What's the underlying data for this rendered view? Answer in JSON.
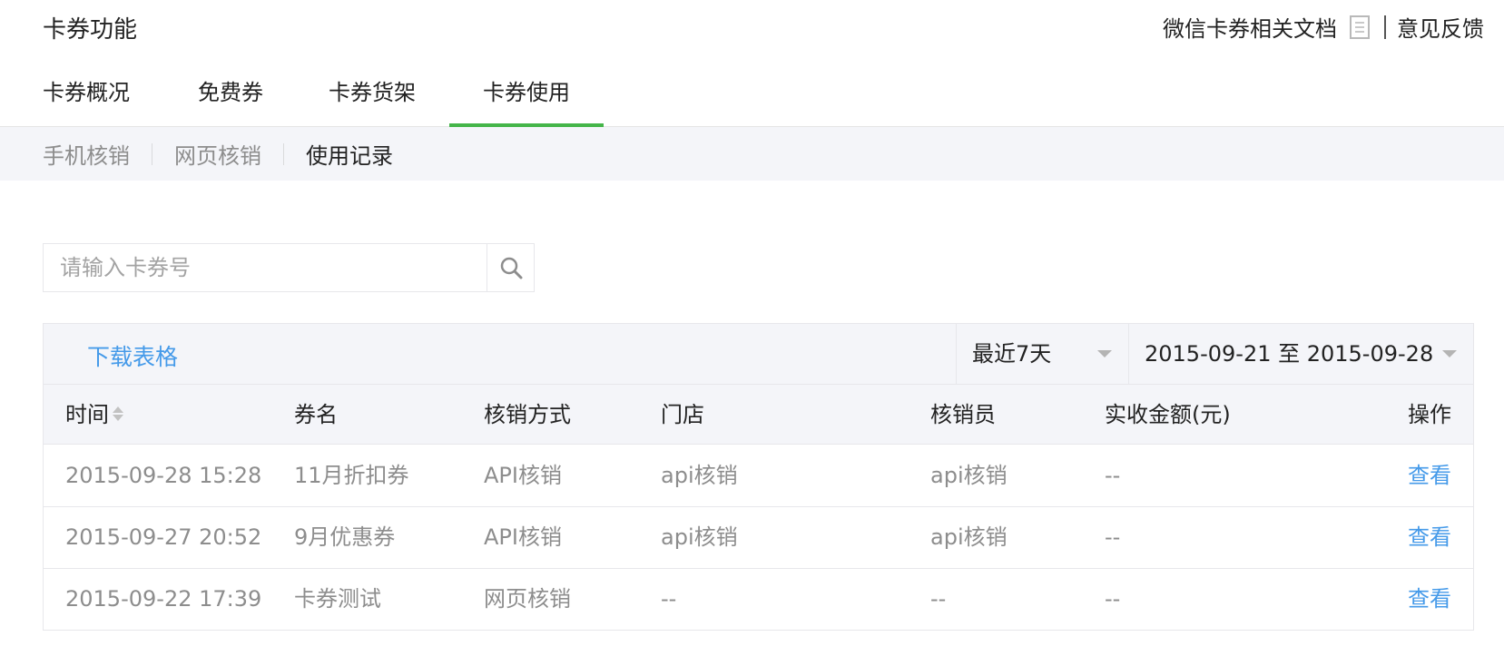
{
  "header": {
    "title": "卡券功能",
    "doc_link": "微信卡券相关文档",
    "feedback": "意见反馈"
  },
  "tabs": [
    {
      "label": "卡券概况"
    },
    {
      "label": "免费券"
    },
    {
      "label": "卡券货架"
    },
    {
      "label": "卡券使用",
      "active": true
    }
  ],
  "subnav": [
    {
      "label": "手机核销"
    },
    {
      "label": "网页核销"
    },
    {
      "label": "使用记录",
      "active": true
    }
  ],
  "search": {
    "placeholder": "请输入卡券号",
    "icon": "search-icon"
  },
  "toolbar": {
    "download": "下载表格",
    "range_select": "最近7天",
    "date_range": "2015-09-21 至 2015-09-28"
  },
  "table": {
    "columns": [
      "时间",
      "券名",
      "核销方式",
      "门店",
      "核销员",
      "实收金额(元)",
      "操作"
    ],
    "rows": [
      [
        "2015-09-28 15:28",
        "11月折扣券",
        "API核销",
        "api核销",
        "api核销",
        "--",
        "查看"
      ],
      [
        "2015-09-27 20:52",
        "9月优惠券",
        "API核销",
        "api核销",
        "api核销",
        "--",
        "查看"
      ],
      [
        "2015-09-22 17:39",
        "卡券测试",
        "网页核销",
        "--",
        "--",
        "--",
        "查看"
      ]
    ]
  },
  "colors": {
    "accent_green": "#44b549",
    "link_blue": "#459ae9",
    "bar_gray": "#f4f5f9"
  }
}
